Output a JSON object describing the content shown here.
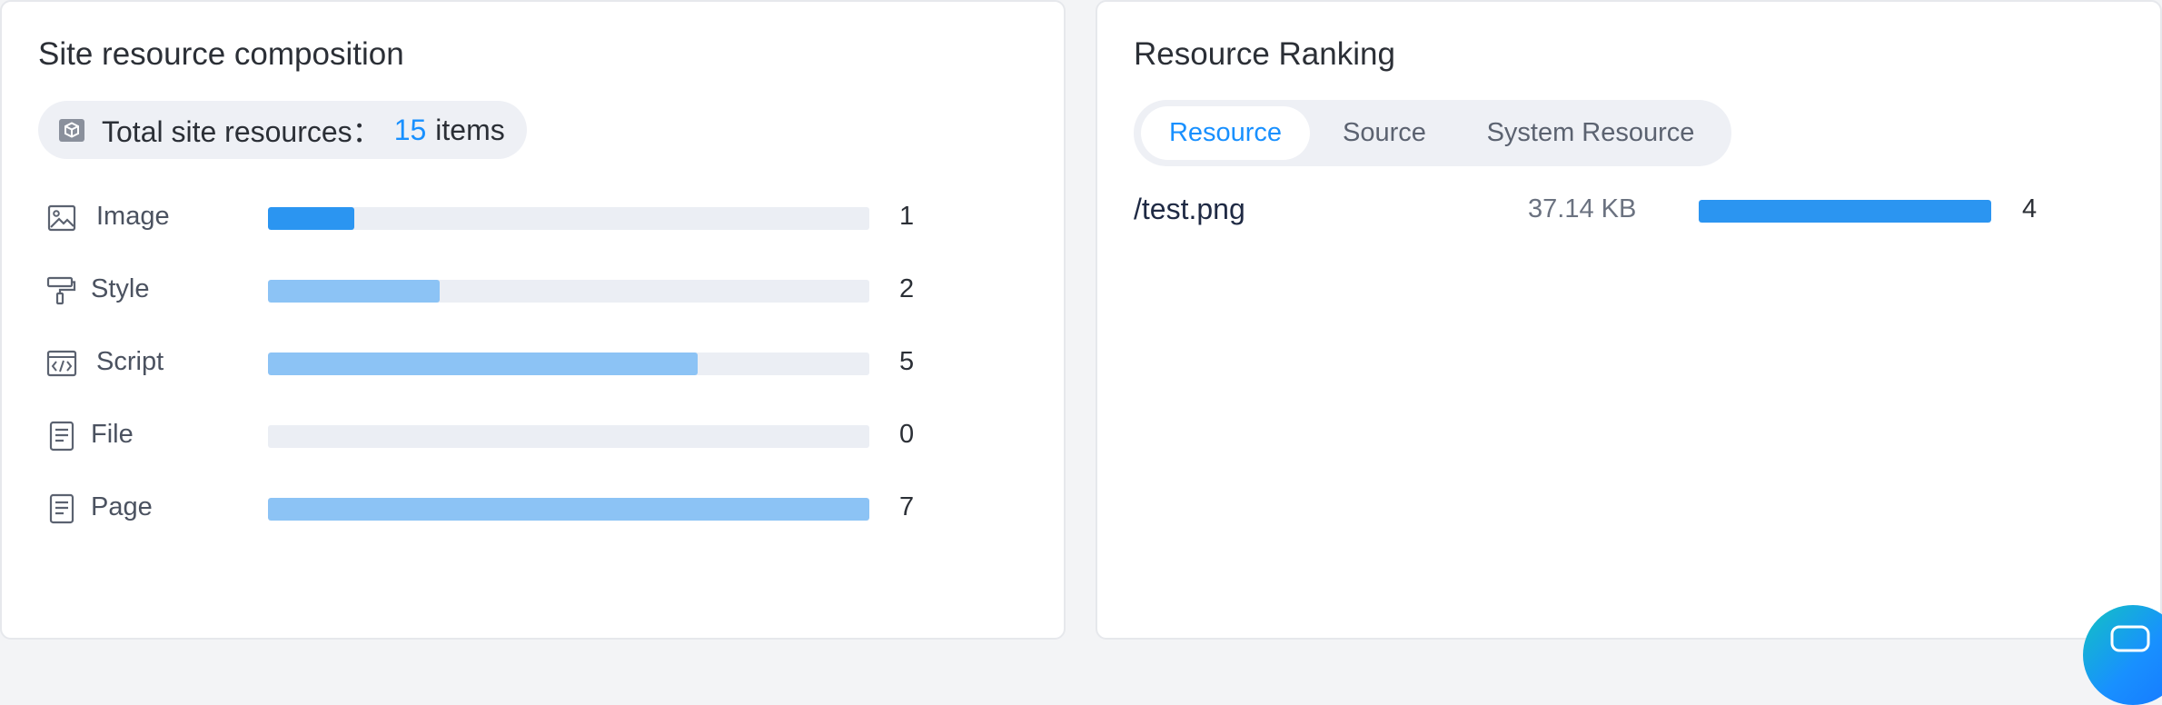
{
  "composition": {
    "title": "Site resource composition",
    "total_prefix": "Total site resources：",
    "total_count": "15",
    "total_suffix": "items",
    "total_icon": "cube-icon",
    "items": [
      {
        "label": "Image",
        "count": "1",
        "value": 1,
        "icon": "image-icon",
        "color": "#2b95f1"
      },
      {
        "label": "Style",
        "count": "2",
        "value": 2,
        "icon": "brush-icon",
        "color": "#8cc3f5"
      },
      {
        "label": "Script",
        "count": "5",
        "value": 5,
        "icon": "code-icon",
        "color": "#8cc3f5"
      },
      {
        "label": "File",
        "count": "0",
        "value": 0,
        "icon": "file-icon",
        "color": "#8cc3f5"
      },
      {
        "label": "Page",
        "count": "7",
        "value": 7,
        "icon": "page-icon",
        "color": "#8cc3f5"
      }
    ],
    "max_value": 7
  },
  "ranking": {
    "title": "Resource Ranking",
    "tabs": [
      {
        "label": "Resource",
        "active": true
      },
      {
        "label": "Source",
        "active": false
      },
      {
        "label": "System Resource",
        "active": false
      }
    ],
    "rows": [
      {
        "name": "/test.png",
        "size": "37.14 KB",
        "count": "4",
        "value": 4,
        "color": "#2b95f1"
      }
    ],
    "max_value": 4
  },
  "floating_button": {
    "icon": "chat-icon"
  },
  "colors": {
    "accent": "#1890ff",
    "bar_primary": "#2b95f1",
    "bar_light": "#8cc3f5",
    "track": "#ebeef4"
  }
}
